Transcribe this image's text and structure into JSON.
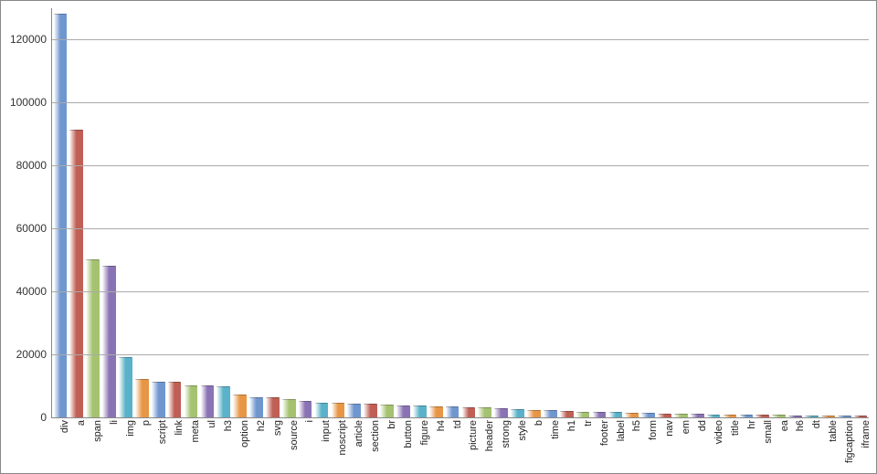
{
  "chart_data": {
    "type": "bar",
    "title": "",
    "xlabel": "",
    "ylabel": "",
    "ylim": [
      0,
      130000
    ],
    "y_ticks": [
      0,
      20000,
      40000,
      60000,
      80000,
      100000,
      120000
    ],
    "categories": [
      "div",
      "a",
      "span",
      "li",
      "img",
      "p",
      "script",
      "link",
      "meta",
      "ul",
      "h3",
      "option",
      "h2",
      "svg",
      "source",
      "i",
      "input",
      "noscript",
      "article",
      "section",
      "br",
      "button",
      "figure",
      "h4",
      "td",
      "picture",
      "header",
      "strong",
      "style",
      "b",
      "time",
      "h1",
      "tr",
      "footer",
      "label",
      "h5",
      "form",
      "nav",
      "em",
      "dd",
      "video",
      "title",
      "hr",
      "small",
      "ea",
      "h6",
      "dt",
      "table",
      "figcaption",
      "iframe"
    ],
    "values": [
      128000,
      91000,
      50000,
      48000,
      19000,
      12000,
      11000,
      11000,
      10000,
      10000,
      9500,
      7000,
      6000,
      6000,
      5500,
      5000,
      4500,
      4500,
      4000,
      4000,
      3800,
      3500,
      3500,
      3200,
      3200,
      3000,
      2800,
      2700,
      2200,
      2100,
      2000,
      1800,
      1600,
      1500,
      1400,
      1300,
      1100,
      1000,
      900,
      800,
      700,
      600,
      550,
      500,
      450,
      400,
      350,
      300,
      250,
      220
    ],
    "colors": [
      "#6f97cf",
      "#c05f55",
      "#a4c270",
      "#8a73b4",
      "#59b2c9",
      "#e79646",
      "#6f97cf",
      "#c05f55",
      "#a4c270",
      "#8a73b4",
      "#59b2c9",
      "#e79646",
      "#6f97cf",
      "#c05f55",
      "#a4c270",
      "#8a73b4",
      "#59b2c9",
      "#e79646",
      "#6f97cf",
      "#c05f55",
      "#a4c270",
      "#8a73b4",
      "#59b2c9",
      "#e79646",
      "#6f97cf",
      "#c05f55",
      "#a4c270",
      "#8a73b4",
      "#59b2c9",
      "#e79646",
      "#6f97cf",
      "#c05f55",
      "#a4c270",
      "#8a73b4",
      "#59b2c9",
      "#e79646",
      "#6f97cf",
      "#c05f55",
      "#a4c270",
      "#8a73b4",
      "#59b2c9",
      "#e79646",
      "#6f97cf",
      "#c05f55",
      "#a4c270",
      "#8a73b4",
      "#59b2c9",
      "#e79646",
      "#6f97cf",
      "#c05f55"
    ]
  }
}
